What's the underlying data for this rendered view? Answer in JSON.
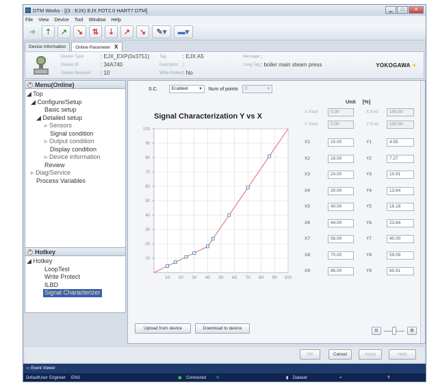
{
  "window": {
    "title": "DTM Works - [(3 : EJX) EJX FDT2.0 HART7 DTM]",
    "min": "▁",
    "max": "□",
    "close": "✕"
  },
  "menu": [
    "File",
    "View",
    "Device",
    "Tool",
    "Window",
    "Help"
  ],
  "toolbar_icons": [
    "back-arrow-icon",
    "connect-icon",
    "upload-icon",
    "download-icon",
    "online-icon",
    "offline-icon",
    "arrow-up-right-icon",
    "arrow-down-right-icon",
    "settings-dropdown-icon",
    "display-dropdown-icon"
  ],
  "tabs": [
    {
      "label": "Device Information"
    },
    {
      "label": "Online Parameter",
      "close": "X"
    }
  ],
  "device": {
    "type_label": "Device Type",
    "type": "EJX_EXP(0x3751)",
    "id_label": "Device ID",
    "id": "34A740",
    "rev_label": "Device Revision",
    "rev": "10",
    "tag_label": "Tag",
    "tag": "EJX A5",
    "desc_label": "Descriptor",
    "desc": "",
    "wp_label": "Write Protect",
    "wp": "No",
    "msg_label": "Message",
    "msg": "",
    "longtag_label": "Long Tag",
    "longtag": "boiler main steam press",
    "vendor": "YOKOGAWA"
  },
  "menu_pane": {
    "title": "Menu(Online)",
    "items": [
      "Top",
      "Configure/Setup",
      "Basic setup",
      "Detailed setup",
      "Sensors",
      "Signal condition",
      "Output condition",
      "Display condition",
      "Device information",
      "Review",
      "Diag/Service",
      "Process Variables"
    ]
  },
  "hotkey_pane": {
    "title": "Hotkey",
    "items": [
      "Hotkey",
      "LoopTest",
      "Write Protect",
      "ILBD",
      "Signal Characterizer"
    ]
  },
  "signal": {
    "sc_label": "S.C.",
    "sc_value": "Enabled",
    "num_label": "Num of points",
    "num_value": "9",
    "unit_label": "Unit",
    "unit_value": "[%]",
    "xstart_label": "X Start",
    "xstart": "0.00",
    "xend_label": "X End",
    "xend": "100.00",
    "ystart_label": "Y Start",
    "ystart": "0.00",
    "yend_label": "Y End",
    "yend": "100.00",
    "points": [
      {
        "xl": "X1",
        "x": "10.00",
        "yl": "Y1",
        "y": "4.55"
      },
      {
        "xl": "X2",
        "x": "16.00",
        "yl": "Y2",
        "y": "7.27"
      },
      {
        "xl": "X3",
        "x": "24.00",
        "yl": "Y3",
        "y": "10.91"
      },
      {
        "xl": "X4",
        "x": "30.00",
        "yl": "Y4",
        "y": "13.64"
      },
      {
        "xl": "X5",
        "x": "40.00",
        "yl": "Y5",
        "y": "18.18"
      },
      {
        "xl": "X6",
        "x": "44.00",
        "yl": "Y6",
        "y": "23.64"
      },
      {
        "xl": "X7",
        "x": "56.00",
        "yl": "Y7",
        "y": "40.00"
      },
      {
        "xl": "X8",
        "x": "70.00",
        "yl": "Y8",
        "y": "59.09"
      },
      {
        "xl": "X9",
        "x": "86.00",
        "yl": "Y9",
        "y": "80.91"
      }
    ],
    "upload": "Upload from device",
    "download": "Download to device"
  },
  "chart_data": {
    "type": "line",
    "title": "Signal Characterization Y vs X",
    "x": [
      0,
      10,
      16,
      24,
      30,
      40,
      44,
      56,
      70,
      86,
      100
    ],
    "y": [
      0,
      4.55,
      7.27,
      10.91,
      13.64,
      18.18,
      23.64,
      40.0,
      59.09,
      80.91,
      100
    ],
    "xlim": [
      0,
      100
    ],
    "ylim": [
      0,
      100
    ],
    "xticks": [
      "10",
      "20",
      "30",
      "40",
      "50",
      "60",
      "70",
      "80",
      "90",
      "100"
    ],
    "yticks": [
      "10",
      "20",
      "30",
      "40",
      "50",
      "60",
      "70",
      "80",
      "90",
      "100"
    ],
    "line_color": "#e0607a",
    "marker_color": "#3a6fb5",
    "grid": true
  },
  "buttons": {
    "ok": "OK",
    "cancel": "Cancel",
    "apply": "Apply",
    "help": "Help"
  },
  "event_viewer": "Event Viewer",
  "status": {
    "user": "DefaultUser",
    "role": "Engineer",
    "mode": "ENG",
    "connected": "Connected",
    "dataset": "Dataset"
  }
}
